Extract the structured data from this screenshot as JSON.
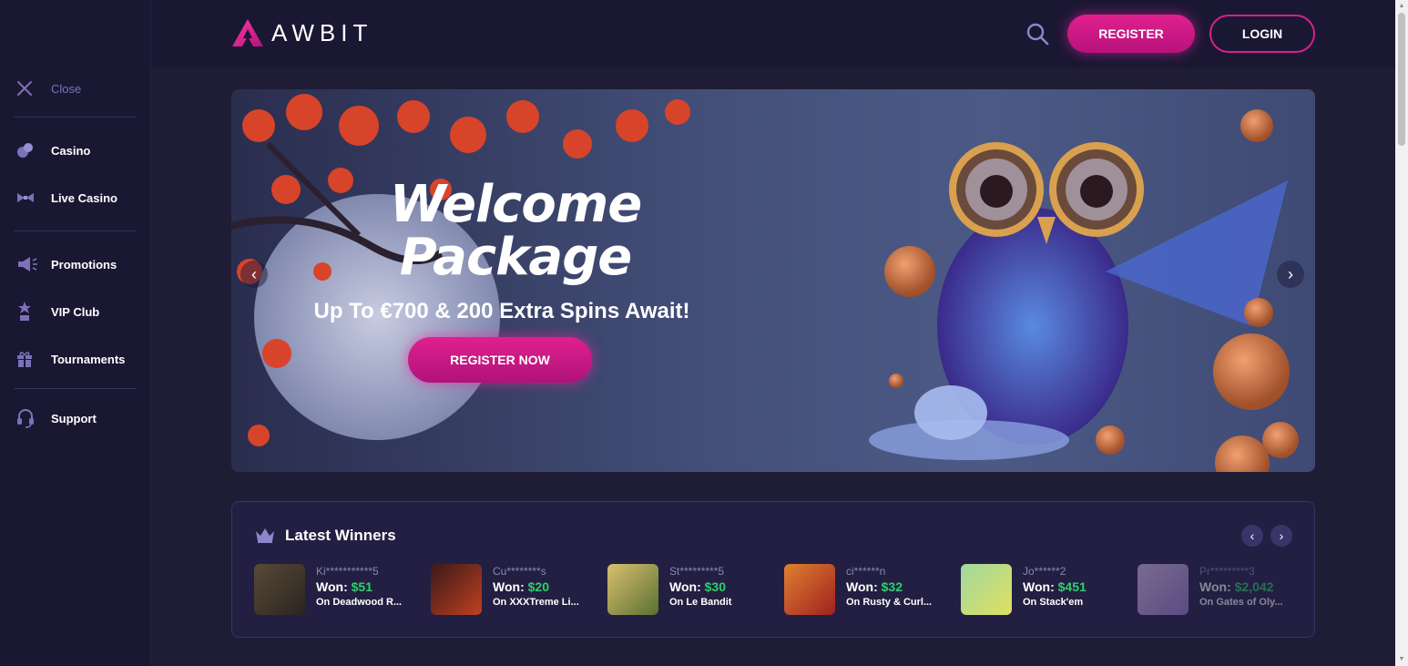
{
  "sidebar": {
    "close_label": "Close",
    "items": [
      {
        "label": "Casino",
        "icon": "casino-chips-icon"
      },
      {
        "label": "Live Casino",
        "icon": "bowtie-icon"
      },
      {
        "label": "Promotions",
        "icon": "megaphone-icon"
      },
      {
        "label": "VIP Club",
        "icon": "vip-trophy-icon"
      },
      {
        "label": "Tournaments",
        "icon": "gift-icon"
      },
      {
        "label": "Support",
        "icon": "headset-icon"
      }
    ]
  },
  "header": {
    "logo_text": "AWBIT",
    "register_label": "REGISTER",
    "login_label": "LOGIN"
  },
  "banner": {
    "title_line1": "Welcome",
    "title_line2": "Package",
    "subtitle": "Up To €700 & 200 Extra Spins Await!",
    "cta_label": "REGISTER NOW",
    "prev_arrow": "‹",
    "next_arrow": "›"
  },
  "winners": {
    "title": "Latest Winners",
    "won_label": "Won:",
    "prev_arrow": "‹",
    "next_arrow": "›",
    "items": [
      {
        "user": "Ki***********5",
        "amount": "$51",
        "game": "On Deadwood R..."
      },
      {
        "user": "Cu********s",
        "amount": "$20",
        "game": "On XXXTreme Li..."
      },
      {
        "user": "St*********5",
        "amount": "$30",
        "game": "On Le Bandit"
      },
      {
        "user": "ci******n",
        "amount": "$32",
        "game": "On Rusty & Curl..."
      },
      {
        "user": "Jo******2",
        "amount": "$451",
        "game": "On Stack'em"
      },
      {
        "user": "Pr*********3",
        "amount": "$2,042",
        "game": "On Gates of Oly..."
      }
    ]
  },
  "colors": {
    "accent": "#e0208f",
    "win_green": "#2ed06a",
    "bg": "#1c1b33"
  }
}
